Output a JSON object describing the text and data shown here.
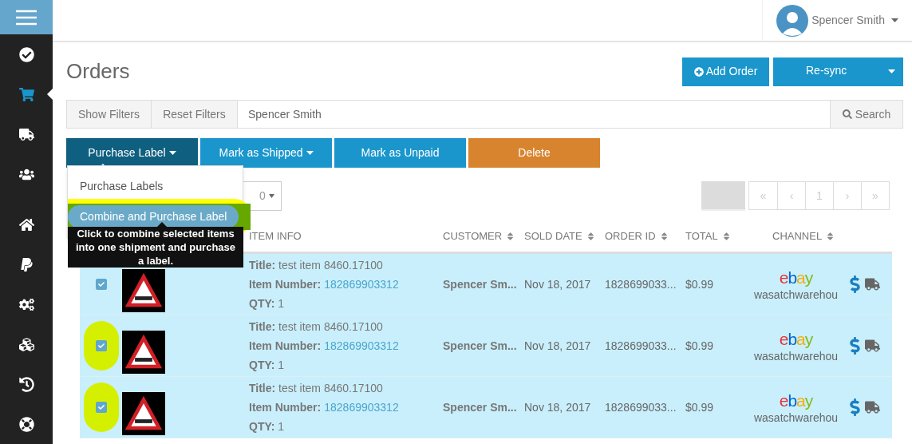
{
  "sidebar": {
    "items": [
      {
        "selected": false
      },
      {
        "selected": true
      },
      {
        "selected": false
      },
      {
        "selected": false
      },
      {
        "selected": false
      },
      {
        "selected": false
      },
      {
        "selected": false
      },
      {
        "selected": false
      },
      {
        "selected": false
      },
      {
        "selected": false
      }
    ]
  },
  "user": {
    "name": "Spencer Smith"
  },
  "page_title": "Orders",
  "header_buttons": {
    "add": "Add Order",
    "resync": "Re-sync"
  },
  "filters": {
    "show": "Show Filters",
    "reset": "Reset Filters",
    "search_value": "Spencer Smith",
    "search_button": "Search"
  },
  "actions": [
    {
      "label": "Purchase Label",
      "kind": "dropdown",
      "color": "#0f5f80",
      "expanded": true
    },
    {
      "label": "Mark as Shipped",
      "kind": "dropdown",
      "color": "#1a96cc",
      "expanded": false
    },
    {
      "label": "Mark as Unpaid",
      "kind": "plain",
      "color": "#1a96cc",
      "expanded": false
    },
    {
      "label": "Delete",
      "kind": "plain",
      "color": "#d8842f",
      "expanded": false
    }
  ],
  "menu": {
    "items": [
      {
        "label": "Purchase Labels",
        "annotated": false
      },
      {
        "label": "Combine and Purchase Label",
        "annotated": true
      }
    ]
  },
  "tooltip": "Click to combine selected items into one shipment and purchase a label.",
  "page_size": {
    "value": "0"
  },
  "pager": [
    {
      "label": "«",
      "disabled": true
    },
    {
      "label": "‹",
      "disabled": true
    },
    {
      "label": "1",
      "disabled": true
    },
    {
      "label": "›",
      "disabled": true
    },
    {
      "label": "»",
      "disabled": true
    }
  ],
  "table": {
    "columns": [
      "ITEM INFO",
      "CUSTOMER",
      "SOLD DATE",
      "ORDER ID",
      "TOTAL",
      "CHANNEL"
    ],
    "rows": [
      {
        "checked": true,
        "annotated": false,
        "title": "**Title:** test item 8460.17100",
        "number_label": "Item Number:",
        "item_number": "182869903312",
        "qty": "**QTY:** 1",
        "customer": "Spencer Sm...",
        "sold_date": "Nov 18, 2017",
        "order_id": "1828699033...",
        "total": "$0.99",
        "channel_logo": "ebay",
        "channel": "wasatchwarehou"
      },
      {
        "checked": true,
        "annotated": true,
        "title": "**Title:** test item 8460.17100",
        "number_label": "Item Number:",
        "item_number": "182869903312",
        "qty": "**QTY:** 1",
        "customer": "Spencer Sm...",
        "sold_date": "Nov 18, 2017",
        "order_id": "1828699033...",
        "total": "$0.99",
        "channel_logo": "ebay",
        "channel": "wasatchwarehou"
      },
      {
        "checked": true,
        "annotated": true,
        "title": "**Title:** test item 8460.17100",
        "number_label": "Item Number:",
        "item_number": "182869903312",
        "qty": "**QTY:** 1",
        "customer": "Spencer Sm...",
        "sold_date": "Nov 18, 2017",
        "order_id": "1828699033...",
        "total": "$0.99",
        "channel_logo": "ebay",
        "channel": "wasatchwarehou"
      }
    ]
  }
}
